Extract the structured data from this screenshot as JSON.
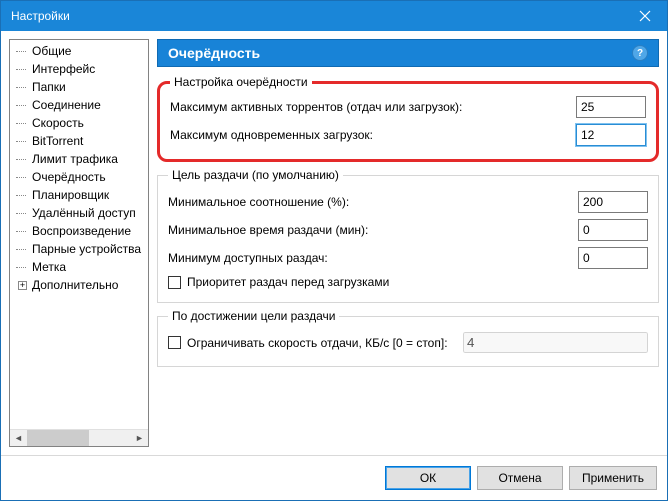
{
  "window": {
    "title": "Настройки"
  },
  "sidebar": {
    "items": [
      {
        "label": "Общие"
      },
      {
        "label": "Интерфейс"
      },
      {
        "label": "Папки"
      },
      {
        "label": "Соединение"
      },
      {
        "label": "Скорость"
      },
      {
        "label": "BitTorrent"
      },
      {
        "label": "Лимит трафика"
      },
      {
        "label": "Очерёдность"
      },
      {
        "label": "Планировщик"
      },
      {
        "label": "Удалённый доступ"
      },
      {
        "label": "Воспроизведение"
      },
      {
        "label": "Парные устройства"
      },
      {
        "label": "Метка"
      },
      {
        "label": "Дополнительно",
        "expandable": true
      }
    ]
  },
  "header": {
    "title": "Очерёдность"
  },
  "groups": {
    "queue": {
      "legend": "Настройка очерёдности",
      "max_active_label": "Максимум активных торрентов (отдач или загрузок):",
      "max_active_value": "25",
      "max_downloads_label": "Максимум одновременных загрузок:",
      "max_downloads_value": "12"
    },
    "seed_goal": {
      "legend": "Цель раздачи (по умолчанию)",
      "ratio_label": "Минимальное соотношение (%):",
      "ratio_value": "200",
      "time_label": "Минимальное время раздачи (мин):",
      "time_value": "0",
      "avail_label": "Минимум доступных раздач:",
      "avail_value": "0",
      "priority_label": "Приоритет раздач перед загрузками"
    },
    "on_goal": {
      "legend": "По достижении цели раздачи",
      "limit_label": "Ограничивать скорость отдачи, КБ/с [0 = стоп]:",
      "limit_value": "4"
    }
  },
  "buttons": {
    "ok": "ОК",
    "cancel": "Отмена",
    "apply": "Применить"
  }
}
